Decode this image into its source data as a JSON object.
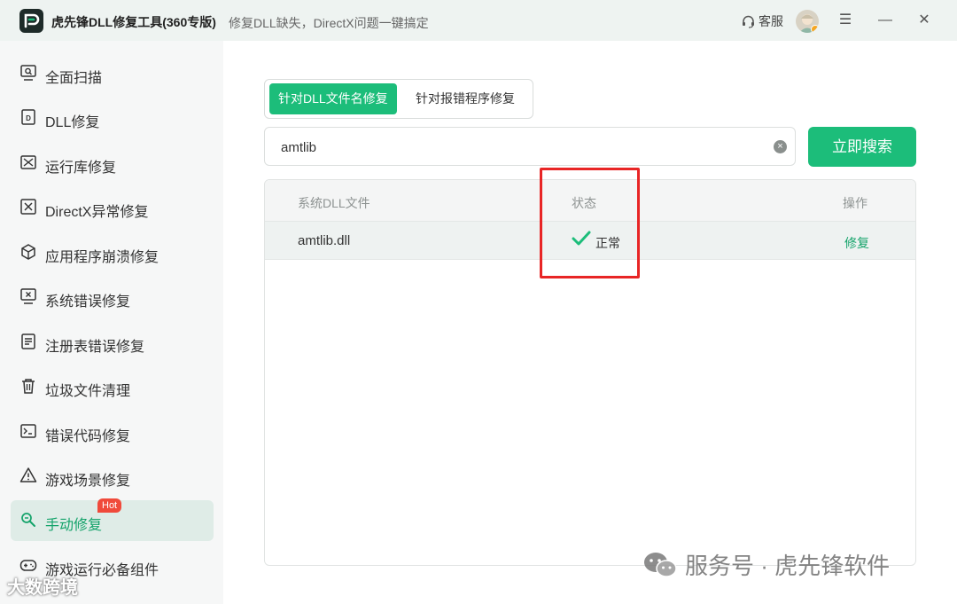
{
  "window": {
    "app_title": "虎先锋DLL修复工具(360专版)",
    "subtitle": "修复DLL缺失，DirectX问题一键搞定",
    "support_label": "客服",
    "accent_color": "#1cbd7a"
  },
  "sidebar": {
    "items": [
      {
        "label": "全面扫描",
        "icon": "scan-icon"
      },
      {
        "label": "DLL修复",
        "icon": "dll-icon"
      },
      {
        "label": "运行库修复",
        "icon": "runtime-icon"
      },
      {
        "label": "DirectX异常修复",
        "icon": "directx-icon"
      },
      {
        "label": "应用程序崩溃修复",
        "icon": "cube-icon"
      },
      {
        "label": "系统错误修复",
        "icon": "monitor-x-icon"
      },
      {
        "label": "注册表错误修复",
        "icon": "registry-icon"
      },
      {
        "label": "垃圾文件清理",
        "icon": "trash-icon"
      },
      {
        "label": "错误代码修复",
        "icon": "terminal-icon"
      },
      {
        "label": "游戏场景修复",
        "icon": "warning-icon"
      },
      {
        "label": "手动修复",
        "icon": "wrench-icon",
        "badge": "Hot",
        "active": true
      },
      {
        "label": "游戏运行必备组件",
        "icon": "gamepad-icon"
      }
    ]
  },
  "main": {
    "tabs": [
      {
        "label": "针对DLL文件名修复",
        "active": true
      },
      {
        "label": "针对报错程序修复",
        "active": false
      }
    ],
    "search": {
      "value": "amtlib",
      "button_label": "立即搜索"
    },
    "table": {
      "columns": [
        "系统DLL文件",
        "状态",
        "操作"
      ],
      "rows": [
        {
          "file": "amtlib.dll",
          "status": "正常",
          "action": "修复"
        }
      ]
    }
  },
  "watermarks": {
    "service": "服务号 · 虎先锋软件",
    "corner": "大数跨境"
  }
}
